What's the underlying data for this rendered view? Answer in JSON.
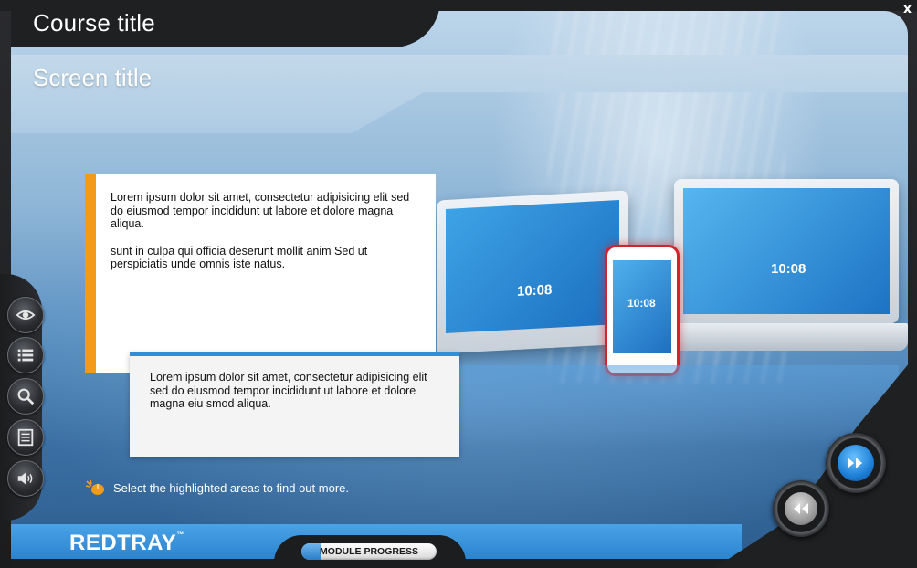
{
  "header": {
    "course_title": "Course title",
    "close_label": "x"
  },
  "screen": {
    "title": "Screen title"
  },
  "sidebar": {
    "buttons": [
      {
        "name": "eye-icon"
      },
      {
        "name": "list-icon"
      },
      {
        "name": "magnifier-icon"
      },
      {
        "name": "notes-icon"
      },
      {
        "name": "speaker-icon"
      }
    ]
  },
  "content": {
    "panel1": {
      "paragraph1": "Lorem ipsum dolor sit amet, consectetur adipisicing elit sed do eiusmod tempor incididunt ut labore et dolore magna aliqua.",
      "paragraph2": "sunt in culpa qui officia deserunt mollit anim Sed ut perspiciatis unde omnis iste natus."
    },
    "panel2": {
      "paragraph1": "Lorem ipsum dolor sit amet, consectetur adipisicing elit sed do eiusmod tempor incididunt ut labore et dolore magna eiu smod aliqua."
    },
    "device_clock": "10:08",
    "hint": "Select the highlighted areas to find out more."
  },
  "footer": {
    "brand": "REDTRAY",
    "trademark": "™",
    "progress_label": "MODULE PROGRESS",
    "progress_fraction": 0.14
  },
  "nav": {
    "next_icon": "double-chevron-right-icon",
    "prev_icon": "double-chevron-left-icon"
  },
  "colors": {
    "accent_orange": "#f39a1a",
    "accent_blue": "#2f8fd8",
    "frame_dark": "#1f2022"
  }
}
